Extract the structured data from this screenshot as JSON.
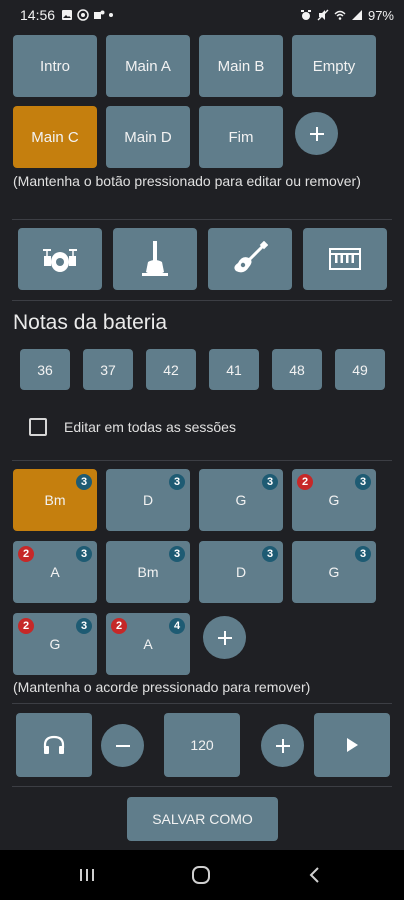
{
  "status": {
    "time": "14:56",
    "battery": "97%",
    "left_icons": [
      "image-icon",
      "whatsapp-icon",
      "teams-icon"
    ],
    "right_icons": [
      "alarm-icon",
      "mute-icon",
      "wifi-icon",
      "signal-icon"
    ]
  },
  "sections": [
    {
      "label": "Intro",
      "active": false
    },
    {
      "label": "Main A",
      "active": false
    },
    {
      "label": "Main B",
      "active": false
    },
    {
      "label": "Empty",
      "active": false
    },
    {
      "label": "Main C",
      "active": true
    },
    {
      "label": "Main D",
      "active": false
    },
    {
      "label": "Fim",
      "active": false
    }
  ],
  "sections_hint": "(Mantenha o botão pressionado para editar ou remover)",
  "instruments": [
    "drums-icon",
    "bass-icon",
    "guitar-icon",
    "keyboard-icon"
  ],
  "drum_heading": "Notas da bateria",
  "drum_notes": [
    "36",
    "37",
    "42",
    "41",
    "48",
    "49"
  ],
  "edit_all_label": "Editar em todas as sessões",
  "chords": [
    {
      "label": "Bm",
      "blue": "3",
      "red": null,
      "active": true
    },
    {
      "label": "D",
      "blue": "3",
      "red": null,
      "active": false
    },
    {
      "label": "G",
      "blue": "3",
      "red": null,
      "active": false
    },
    {
      "label": "G",
      "blue": "3",
      "red": "2",
      "active": false
    },
    {
      "label": "A",
      "blue": "3",
      "red": "2",
      "active": false
    },
    {
      "label": "Bm",
      "blue": "3",
      "red": null,
      "active": false
    },
    {
      "label": "D",
      "blue": "3",
      "red": null,
      "active": false
    },
    {
      "label": "G",
      "blue": "3",
      "red": null,
      "active": false
    },
    {
      "label": "G",
      "blue": "3",
      "red": "2",
      "active": false
    },
    {
      "label": "A",
      "blue": "4",
      "red": "2",
      "active": false
    }
  ],
  "chords_hint": "(Mantenha o acorde pressionado para remover)",
  "tempo": "120",
  "save_label": "SALVAR COMO",
  "colors": {
    "background": "#1f2024",
    "button": "#607d8b",
    "active": "#c57f0e",
    "badge_blue": "#1e5b73",
    "badge_red": "#c62828"
  }
}
